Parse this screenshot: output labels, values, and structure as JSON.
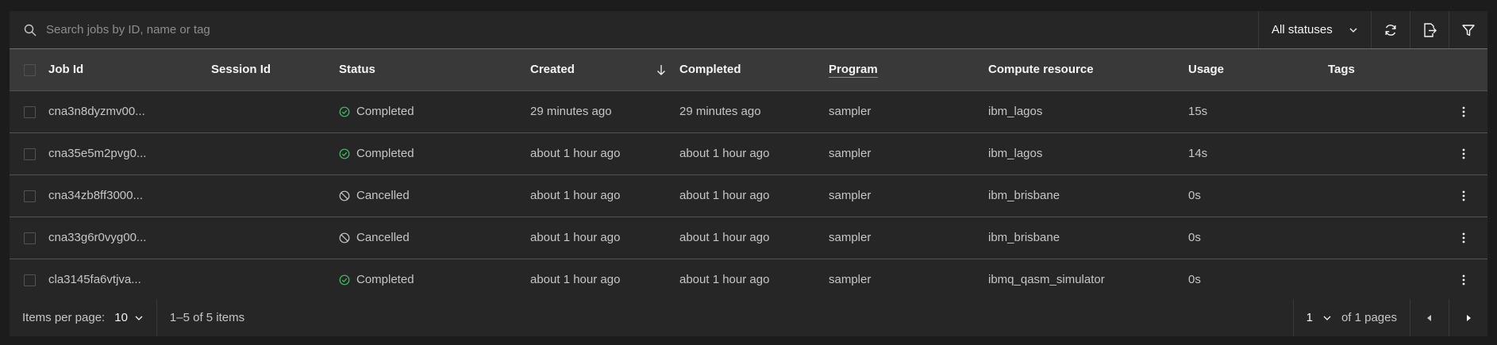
{
  "search": {
    "placeholder": "Search jobs by ID, name or tag"
  },
  "filters": {
    "status_value": "All statuses"
  },
  "toolbar_icons": [
    "refresh-icon",
    "export-icon",
    "filter-icon"
  ],
  "table": {
    "columns": [
      "Job Id",
      "Session Id",
      "Status",
      "Created",
      "Completed",
      "Program",
      "Compute resource",
      "Usage",
      "Tags"
    ],
    "sorted_column": "Created",
    "sort_direction": "descending",
    "rows": [
      {
        "job_id": "cna3n8dyzmv00...",
        "session_id": "",
        "status": "Completed",
        "created": "29 minutes ago",
        "completed": "29 minutes ago",
        "program": "sampler",
        "resource": "ibm_lagos",
        "usage": "15s",
        "tags": ""
      },
      {
        "job_id": "cna35e5m2pvg0...",
        "session_id": "",
        "status": "Completed",
        "created": "about 1 hour ago",
        "completed": "about 1 hour ago",
        "program": "sampler",
        "resource": "ibm_lagos",
        "usage": "14s",
        "tags": ""
      },
      {
        "job_id": "cna34zb8ff3000...",
        "session_id": "",
        "status": "Cancelled",
        "created": "about 1 hour ago",
        "completed": "about 1 hour ago",
        "program": "sampler",
        "resource": "ibm_brisbane",
        "usage": "0s",
        "tags": ""
      },
      {
        "job_id": "cna33g6r0vyg00...",
        "session_id": "",
        "status": "Cancelled",
        "created": "about 1 hour ago",
        "completed": "about 1 hour ago",
        "program": "sampler",
        "resource": "ibm_brisbane",
        "usage": "0s",
        "tags": ""
      },
      {
        "job_id": "cla3145fa6vtjva...",
        "session_id": "",
        "status": "Completed",
        "created": "about 1 hour ago",
        "completed": "about 1 hour ago",
        "program": "sampler",
        "resource": "ibmq_qasm_simulator",
        "usage": "0s",
        "tags": ""
      }
    ]
  },
  "pagination": {
    "items_per_page_label": "Items per page:",
    "items_per_page": "10",
    "range_text": "1–5 of 5 items",
    "current_page": "1",
    "total_pages_text": "of 1 pages"
  },
  "colors": {
    "background": "#1c1c1c",
    "panel": "#262626",
    "header": "#393939",
    "completed": "#42be65",
    "cancelled": "#c6c6c6"
  }
}
